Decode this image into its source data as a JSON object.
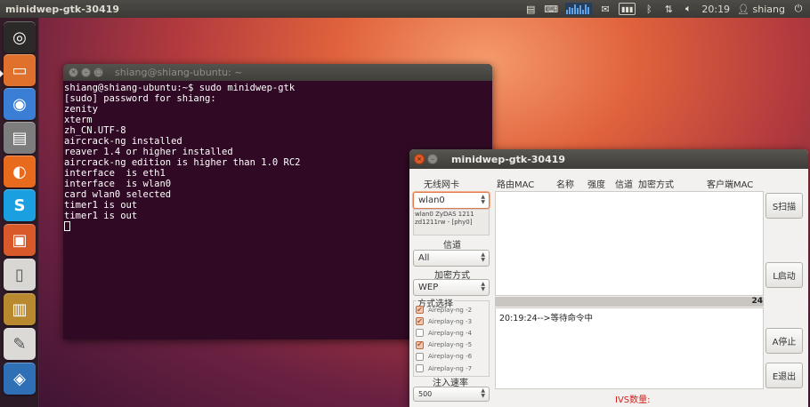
{
  "top_panel": {
    "window_title": "minidwep-gtk-30419",
    "keyboard_indicator": "⌨",
    "clock": "20:19",
    "user": "shiang"
  },
  "launcher": {
    "items": [
      {
        "name": "dash-home",
        "glyph": "◎",
        "color": "#2c2a29"
      },
      {
        "name": "files",
        "glyph": "▭",
        "color": "#e0712c"
      },
      {
        "name": "chromium",
        "glyph": "◉",
        "color": "#3a7fd5"
      },
      {
        "name": "drive",
        "glyph": "▤",
        "color": "#7d7d7d"
      },
      {
        "name": "firefox",
        "glyph": "◐",
        "color": "#e86b1d"
      },
      {
        "name": "skype",
        "glyph": "S",
        "color": "#1a9fe0"
      },
      {
        "name": "software-center",
        "glyph": "▣",
        "color": "#d8592a"
      },
      {
        "name": "document-viewer",
        "glyph": "▯",
        "color": "#d9d7d3"
      },
      {
        "name": "dictionary",
        "glyph": "▥",
        "color": "#b9892f"
      },
      {
        "name": "text-editor",
        "glyph": "✎",
        "color": "#dcdad6"
      },
      {
        "name": "settings",
        "glyph": "◈",
        "color": "#2f6fb6"
      }
    ]
  },
  "terminal": {
    "title": "shiang@shiang-ubuntu: ~",
    "lines": [
      "shiang@shiang-ubuntu:~$ sudo minidwep-gtk",
      "[sudo] password for shiang:",
      "zenity",
      "xterm",
      "zh_CN.UTF-8",
      "aircrack-ng installed",
      "reaver 1.4 or higher installed",
      "aircrack-ng edition is higher than 1.0 RC2",
      "interface  is eth1",
      "interface  is wlan0",
      "card wlan0 selected",
      "timer1 is out",
      "timer1 is out"
    ]
  },
  "minidwep": {
    "title": "minidwep-gtk-30419",
    "wireless_card_label": "无线网卡",
    "wireless_card_value": "wlan0",
    "card_info": "wlan0 ZyDAS 1211\nzd1211rw - [phy0]",
    "channel_label": "信道",
    "channel_value": "All",
    "encryption_label": "加密方式",
    "encryption_value": "WEP",
    "mode_label": "方式选择",
    "modes": [
      {
        "label": "Aireplay-ng -2",
        "checked": true
      },
      {
        "label": "Aireplay-ng -3",
        "checked": true
      },
      {
        "label": "Aireplay-ng -4",
        "checked": false
      },
      {
        "label": "Aireplay-ng -5",
        "checked": true
      },
      {
        "label": "Aireplay-ng -6",
        "checked": false
      },
      {
        "label": "Aireplay-ng -7",
        "checked": false
      }
    ],
    "inject_rate_label": "注入速率",
    "inject_rate_value": "500",
    "columns": {
      "bssid": "路由MAC",
      "name": "名称",
      "strength": "强度",
      "channel": "信道",
      "encryption": "加密方式",
      "client_mac": "客户端MAC"
    },
    "counter": "24",
    "log": "20:19:24-->等待命令中",
    "ivs_label": "IVS数量:",
    "buttons": {
      "scan": "S扫描",
      "launch": "L启动",
      "abort": "A停止",
      "exit": "E退出"
    }
  }
}
